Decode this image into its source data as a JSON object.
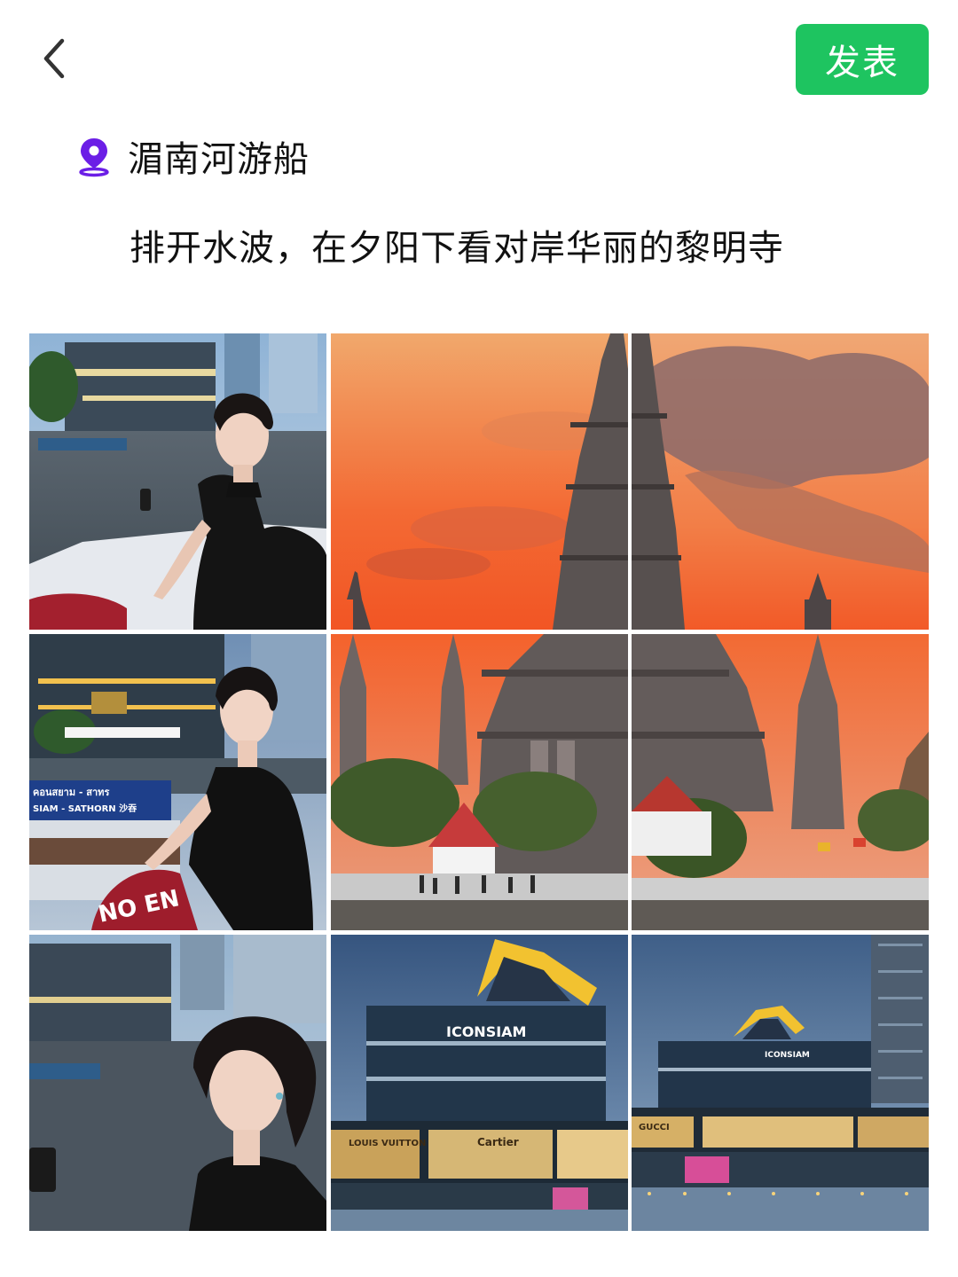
{
  "header": {
    "back_icon": "chevron-left-icon",
    "publish_label": "发表",
    "accent_color": "#1ec460"
  },
  "location": {
    "icon": "location-pin-icon",
    "icon_color": "#6b1ee6",
    "name": "湄南河游船"
  },
  "caption": {
    "text": "排开水波，在夕阳下看对岸华丽的黎明寺"
  },
  "photos": [
    {
      "subject": "woman-on-boat-river-icon"
    },
    {
      "subject": "wat-arun-sunset-left-icon"
    },
    {
      "subject": "wat-arun-sunset-right-icon"
    },
    {
      "subject": "woman-on-boat-pier-icon"
    },
    {
      "subject": "wat-arun-temple-dusk-left-icon"
    },
    {
      "subject": "wat-arun-temple-dusk-right-icon"
    },
    {
      "subject": "woman-portrait-river-icon"
    },
    {
      "subject": "iconsiam-mall-closeup-icon"
    },
    {
      "subject": "iconsiam-mall-riverside-icon"
    }
  ],
  "signs": {
    "boat_thai": "คอนสยาม - สาทร",
    "boat_en": "SIAM - SATHORN 沙吞",
    "no_entry": "NO EN",
    "iconsiam_1": "ICONSIAM",
    "iconsiam_2": "ICONSIAM",
    "brand_gucci": "GUCCI",
    "brand_lv": "LOUIS VUITTON",
    "brand_cartier": "Cartier"
  }
}
